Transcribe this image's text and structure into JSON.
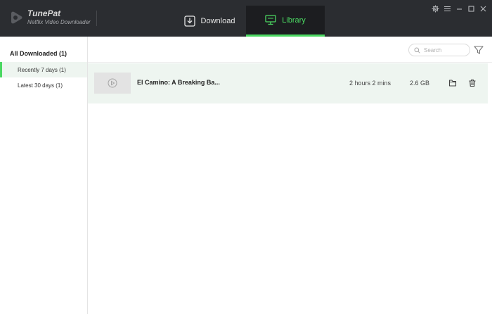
{
  "app": {
    "name": "TunePat",
    "subtitle": "Netflix Video Downloader",
    "colors": {
      "accent": "#4bd862",
      "titlebar": "#2b2d31",
      "active_tab": "#1c1d20",
      "row_bg": "#eef5f0"
    },
    "icons": [
      "logo-icon",
      "download-icon",
      "library-monitor-icon",
      "gear-icon",
      "menu-icon",
      "minimize-icon",
      "maximize-icon",
      "close-icon",
      "search-icon",
      "filter-icon",
      "play-icon",
      "folder-icon",
      "trash-icon"
    ]
  },
  "tabs": {
    "download": {
      "label": "Download"
    },
    "library": {
      "label": "Library",
      "active": true
    }
  },
  "sidebar": {
    "all": "All Downloaded (1)",
    "items": [
      {
        "label": "Recently 7 days (1)",
        "active": true
      },
      {
        "label": "Latest 30 days (1)",
        "active": false
      }
    ]
  },
  "search": {
    "placeholder": "Search",
    "value": ""
  },
  "library": {
    "rows": [
      {
        "title": "El Camino: A Breaking Ba...",
        "duration": "2 hours 2 mins",
        "size": "2.6 GB"
      }
    ]
  }
}
